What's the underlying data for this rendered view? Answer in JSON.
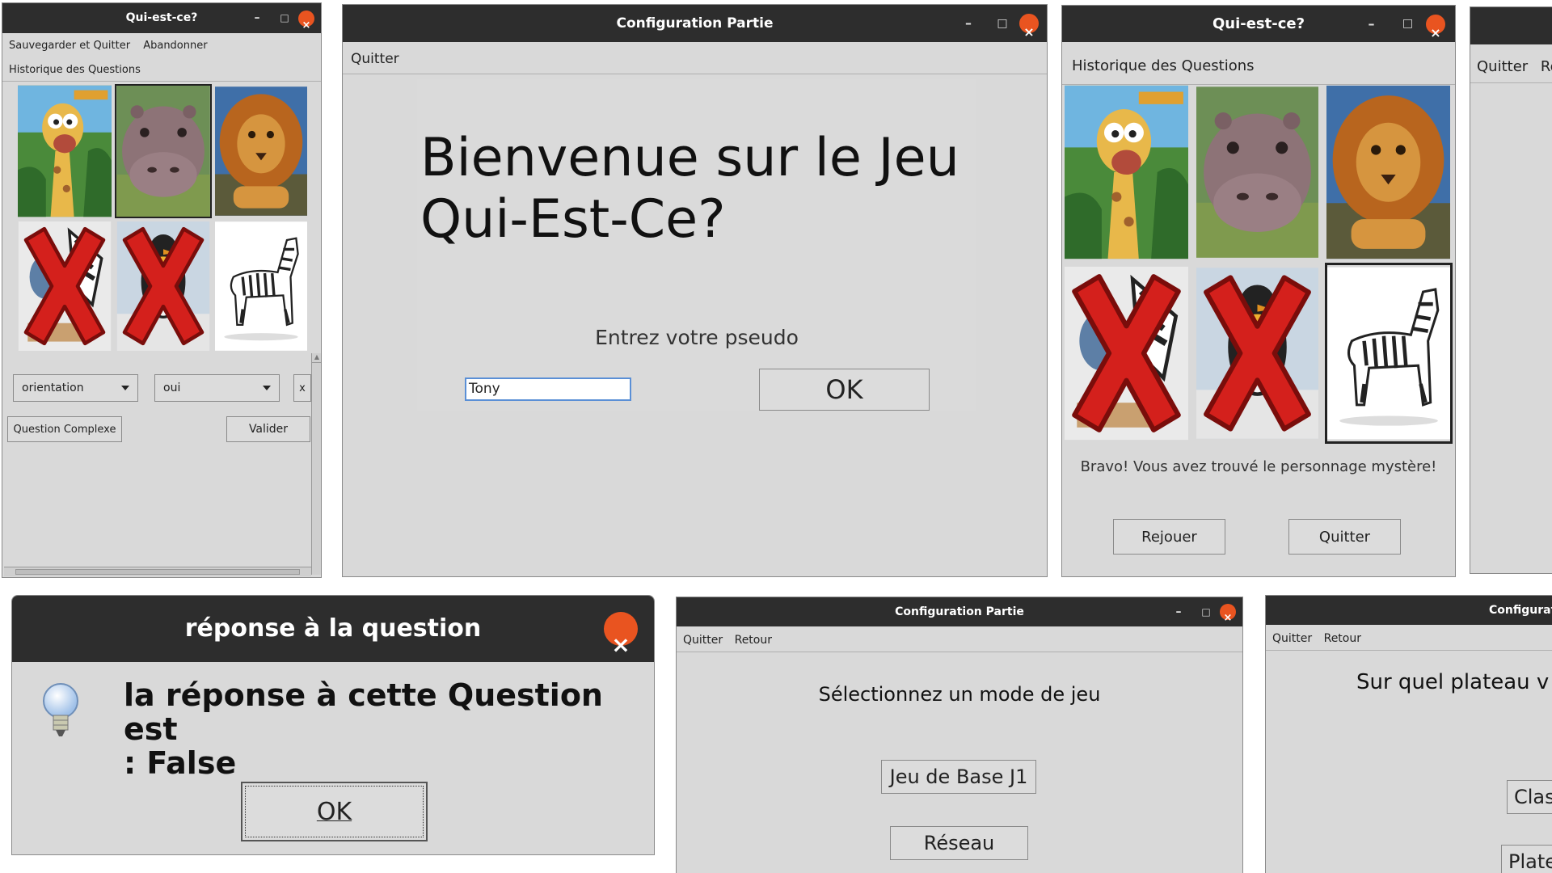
{
  "windows": {
    "game_left": {
      "title": "Qui-est-ce?",
      "menu": [
        "Sauvegarder et Quitter",
        "Abandonner"
      ],
      "submenu": "Historique des Questions",
      "attribute_select": "orientation",
      "value_select": "oui",
      "clear_button": "x",
      "complex_button": "Question Complexe",
      "validate_button": "Valider",
      "cards": [
        {
          "animal": "giraffe",
          "crossed": false,
          "selected": false
        },
        {
          "animal": "hippo",
          "crossed": false,
          "selected": true
        },
        {
          "animal": "lion",
          "crossed": false,
          "selected": false
        },
        {
          "animal": "zebra-cartoon",
          "crossed": true,
          "selected": false
        },
        {
          "animal": "penguin",
          "crossed": true,
          "selected": false
        },
        {
          "animal": "zebra",
          "crossed": false,
          "selected": false
        }
      ]
    },
    "config_pseudo": {
      "title": "Configuration Partie",
      "menu": [
        "Quitter"
      ],
      "welcome_line1": "Bienvenue sur le Jeu",
      "welcome_line2": "Qui-Est-Ce?",
      "pseudo_label": "Entrez votre pseudo",
      "pseudo_value": "Tony",
      "ok_button": "OK"
    },
    "game_won": {
      "title": "Qui-est-ce?",
      "menu": [
        "Historique des Questions"
      ],
      "win_message": "Bravo! Vous avez trouvé le personnage mystère!",
      "replay_button": "Rejouer",
      "quit_button": "Quitter"
    },
    "partial_right": {
      "menu": [
        "Quitter",
        "Re"
      ]
    },
    "answer_dialog": {
      "title": "réponse à la question",
      "message_line1": "la réponse à cette Question est",
      "message_line2": ": False",
      "ok_button": "OK",
      "icon": "lightbulb-icon"
    },
    "config_mode": {
      "title": "Configuration Partie",
      "menu": [
        "Quitter",
        "Retour"
      ],
      "prompt": "Sélectionnez un mode de jeu",
      "mode_base": "Jeu de Base J1",
      "mode_network": "Réseau"
    },
    "config_board": {
      "title": "Configurati",
      "menu": [
        "Quitter",
        "Retour"
      ],
      "prompt": "Sur quel plateau v",
      "option_classic": "Clas",
      "option_plateau": "Platea"
    }
  },
  "colors": {
    "titlebar": "#2d2d2d",
    "window_bg": "#d9d9d9",
    "close": "#e95420",
    "cross": "#d4201c"
  },
  "window_controls": {
    "minimize": "–",
    "maximize": "□",
    "close": "×"
  }
}
